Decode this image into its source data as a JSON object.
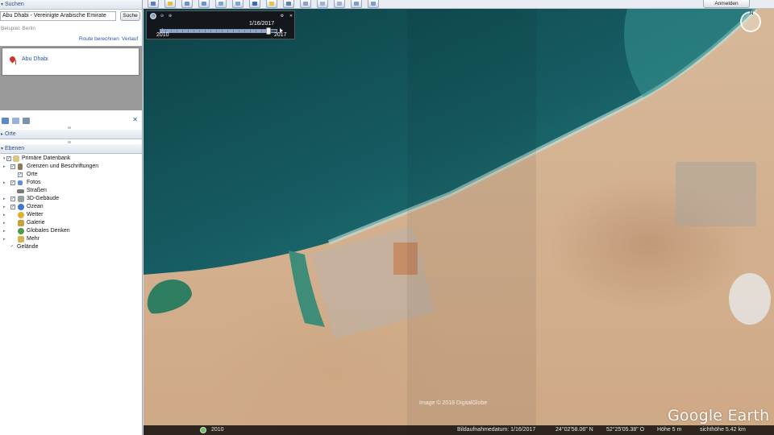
{
  "toolbar": {
    "icons": [
      "sidebar-toggle",
      "placemark",
      "polygon",
      "path",
      "overlay",
      "tour",
      "historical-imagery",
      "sunlight",
      "sky",
      "measure",
      "email",
      "print",
      "save-image",
      "view-in-maps"
    ],
    "login_label": "Anmelden"
  },
  "search": {
    "header": "Suchen",
    "query": "Abu Dhabi - Vereinigte Arabische Emirate",
    "button": "Suche",
    "hint": "Beispiel: Berlin",
    "route_link": "Route berechnen",
    "history_link": "Verlauf",
    "result": "Abu Dhabi"
  },
  "places": {
    "header": "Orte"
  },
  "layers": {
    "header": "Ebenen",
    "items": [
      {
        "label": "Primäre Datenbank",
        "checked": true,
        "expander": "▾"
      },
      {
        "label": "Grenzen und Beschriftungen",
        "checked": true,
        "expander": "▸"
      },
      {
        "label": "Orte",
        "checked": true,
        "expander": ""
      },
      {
        "label": "Fotos",
        "checked": true,
        "expander": "▸"
      },
      {
        "label": "Straßen",
        "checked": true,
        "expander": ""
      },
      {
        "label": "3D-Gebäude",
        "checked": true,
        "expander": "▸"
      },
      {
        "label": "Ozean",
        "checked": true,
        "expander": "▸"
      },
      {
        "label": "Wetter",
        "checked": true,
        "expander": "▸"
      },
      {
        "label": "Galerie",
        "checked": true,
        "expander": "▸"
      },
      {
        "label": "Globales Denken",
        "checked": true,
        "expander": "▸"
      },
      {
        "label": "Mehr",
        "checked": true,
        "expander": "▸"
      },
      {
        "label": "Gelände",
        "checked": true,
        "expander": ""
      }
    ]
  },
  "time_slider": {
    "date": "1/16/2017",
    "start_year": "2010",
    "end_year": "2017",
    "position": 0.93
  },
  "map": {
    "watermark": "Image © 2018 DigitalGlobe",
    "logo": "Google Earth",
    "compass": "N"
  },
  "status": {
    "year": "2010",
    "imagery_date": "Bildaufnahmedatum: 1/16/2017",
    "lat": "24°02'58.06\" N",
    "lon": "52°25'05.38\" O",
    "elevation": "Höhe   5 m",
    "eye_alt": "sichthöhe   5.42 km"
  },
  "colors": {
    "sea_deep": "#0f4a50",
    "sea_shallow": "#2d8a8a",
    "sand": "#d3b08e",
    "link": "#2456a8"
  }
}
